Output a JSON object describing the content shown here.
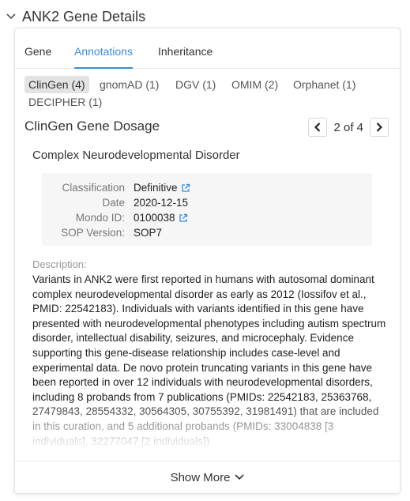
{
  "header": {
    "title": "ANK2 Gene Details"
  },
  "tabs": [
    {
      "label": "Gene"
    },
    {
      "label": "Annotations"
    },
    {
      "label": "Inheritance"
    }
  ],
  "active_tab": "Annotations",
  "sources": [
    {
      "label": "ClinGen (4)"
    },
    {
      "label": "gnomAD (1)"
    },
    {
      "label": "DGV (1)"
    },
    {
      "label": "OMIM (2)"
    },
    {
      "label": "Orphanet (1)"
    },
    {
      "label": "DECIPHER (1)"
    }
  ],
  "section": {
    "title": "ClinGen Gene Dosage",
    "pager": {
      "label": "2 of 4"
    }
  },
  "disorder": "Complex Neurodevelopmental Disorder",
  "details": [
    {
      "label": "Classification",
      "value": "Definitive",
      "link_icon": "external-link-icon"
    },
    {
      "label": "Date",
      "value": "2020-12-15"
    },
    {
      "label": "Mondo ID:",
      "value": "0100038",
      "link_icon": "external-link-icon"
    },
    {
      "label": "SOP Version:",
      "value": "SOP7"
    }
  ],
  "description": {
    "label": "Description:",
    "text": "Variants in ANK2 were first reported in humans with autosomal dominant complex neurodevelopmental disorder as early as 2012 (Iossifov et al., PMID: 22542183). Individuals with variants identified in this gene have presented with neurodevelopmental phenotypes including autism spectrum disorder, intellectual disability, seizures, and microcephaly. Evidence supporting this gene-disease relationship includes case-level and experimental data. De novo protein truncating variants in this gene have been reported in over 12 individuals with neurodevelopmental disorders, including 8 probands from 7 publications (PMIDs: 22542183, 25363768, 27479843, 28554332, 30564305, 30755392, 31981491) that are included in this curation, and 5 additional probands (PMIDs: 33004838 [3 individuals], 32277047 [2 individuals])"
  },
  "show_more": {
    "label": "Show More"
  },
  "colors": {
    "accent": "#3a8ed8",
    "chip_bg": "#e3e3e3",
    "info_bg": "#f6f6f6"
  }
}
